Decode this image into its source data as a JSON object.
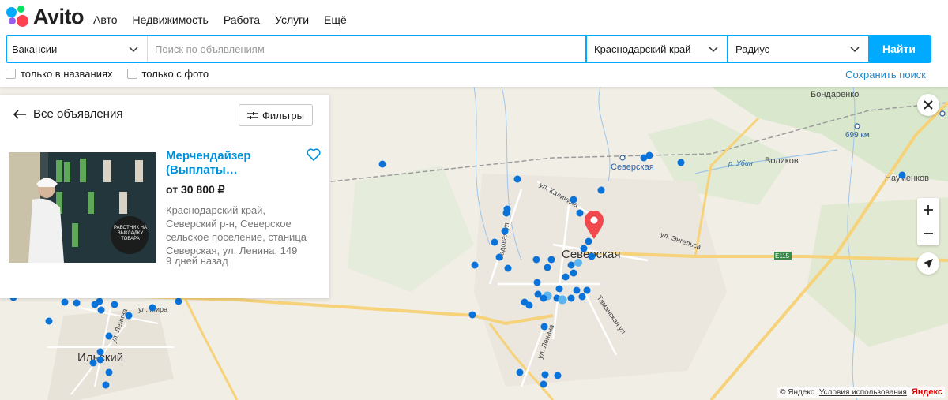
{
  "header": {
    "logo_text": "Avito",
    "nav": [
      "Авто",
      "Недвижимость",
      "Работа",
      "Услуги",
      "Ещё"
    ]
  },
  "search": {
    "category": "Вакансии",
    "query_placeholder": "Поиск по объявлениям",
    "region": "Краснодарский край",
    "radius": "Радиус",
    "submit": "Найти",
    "only_titles": "только в названиях",
    "only_photo": "только с фото",
    "save_search": "Сохранить поиск"
  },
  "panel": {
    "back_label": "Все объявления",
    "filters_label": "Фильтры",
    "listing": {
      "title": "Мерчендайзер (Выплаты…",
      "price": "от 30 800 ₽",
      "address": "Краснодарский край, Северский р-н, Северское сельское поселение, станица Северская, ул. Ленина, 149",
      "date": "9 дней назад",
      "image_badge": "РАБОТНИК НА ВЫКЛАДКУ ТОВАРА"
    }
  },
  "map": {
    "labels": {
      "city": "Северская",
      "station": "Северская",
      "town": "Ильский",
      "street_kalinina": "ул. Калинина",
      "street_engelsa": "ул. Энгельса",
      "street_lenina": "ул. Ленина",
      "street_tamanskaya": "Таманская ул.",
      "street_mira": "ул. Мира",
      "street_sadovaya": "Садовая ул.",
      "street_lenina2": "ул. Ленина",
      "village_bondarenko": "Бондаренко",
      "village_volikov": "Воликов",
      "village_naumenkov": "Науменков",
      "km": "699 км",
      "river": "р. Убин",
      "road": "E115"
    },
    "copyright": "© Яндекс",
    "terms": "Условия использования",
    "brand": "Яндекс"
  },
  "colors": {
    "accent": "#00aaff",
    "link": "#0091d9",
    "marker": "#0a73d9",
    "pin": "#f0484c"
  }
}
